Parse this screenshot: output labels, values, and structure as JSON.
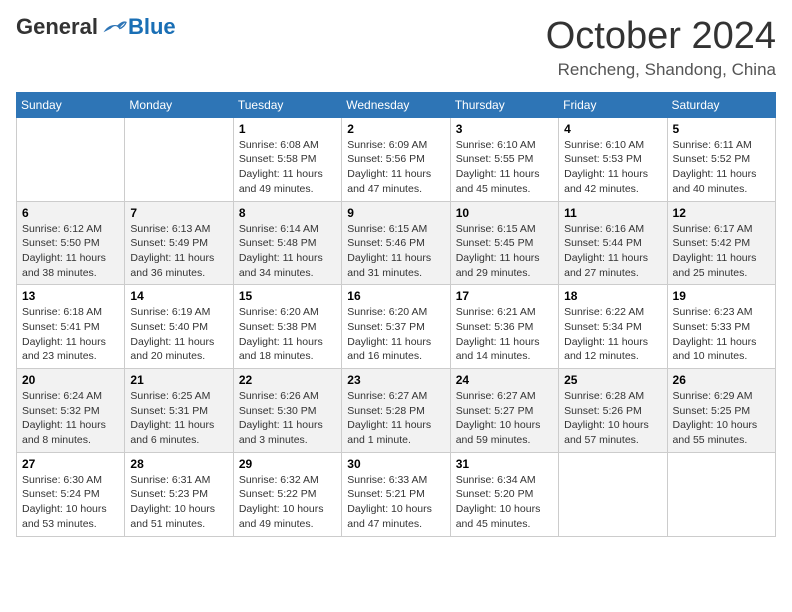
{
  "header": {
    "logo": {
      "general": "General",
      "blue": "Blue"
    },
    "title": "October 2024",
    "subtitle": "Rencheng, Shandong, China"
  },
  "days_of_week": [
    "Sunday",
    "Monday",
    "Tuesday",
    "Wednesday",
    "Thursday",
    "Friday",
    "Saturday"
  ],
  "weeks": [
    [
      {
        "day": "",
        "detail": ""
      },
      {
        "day": "",
        "detail": ""
      },
      {
        "day": "1",
        "detail": "Sunrise: 6:08 AM\nSunset: 5:58 PM\nDaylight: 11 hours and 49 minutes."
      },
      {
        "day": "2",
        "detail": "Sunrise: 6:09 AM\nSunset: 5:56 PM\nDaylight: 11 hours and 47 minutes."
      },
      {
        "day": "3",
        "detail": "Sunrise: 6:10 AM\nSunset: 5:55 PM\nDaylight: 11 hours and 45 minutes."
      },
      {
        "day": "4",
        "detail": "Sunrise: 6:10 AM\nSunset: 5:53 PM\nDaylight: 11 hours and 42 minutes."
      },
      {
        "day": "5",
        "detail": "Sunrise: 6:11 AM\nSunset: 5:52 PM\nDaylight: 11 hours and 40 minutes."
      }
    ],
    [
      {
        "day": "6",
        "detail": "Sunrise: 6:12 AM\nSunset: 5:50 PM\nDaylight: 11 hours and 38 minutes."
      },
      {
        "day": "7",
        "detail": "Sunrise: 6:13 AM\nSunset: 5:49 PM\nDaylight: 11 hours and 36 minutes."
      },
      {
        "day": "8",
        "detail": "Sunrise: 6:14 AM\nSunset: 5:48 PM\nDaylight: 11 hours and 34 minutes."
      },
      {
        "day": "9",
        "detail": "Sunrise: 6:15 AM\nSunset: 5:46 PM\nDaylight: 11 hours and 31 minutes."
      },
      {
        "day": "10",
        "detail": "Sunrise: 6:15 AM\nSunset: 5:45 PM\nDaylight: 11 hours and 29 minutes."
      },
      {
        "day": "11",
        "detail": "Sunrise: 6:16 AM\nSunset: 5:44 PM\nDaylight: 11 hours and 27 minutes."
      },
      {
        "day": "12",
        "detail": "Sunrise: 6:17 AM\nSunset: 5:42 PM\nDaylight: 11 hours and 25 minutes."
      }
    ],
    [
      {
        "day": "13",
        "detail": "Sunrise: 6:18 AM\nSunset: 5:41 PM\nDaylight: 11 hours and 23 minutes."
      },
      {
        "day": "14",
        "detail": "Sunrise: 6:19 AM\nSunset: 5:40 PM\nDaylight: 11 hours and 20 minutes."
      },
      {
        "day": "15",
        "detail": "Sunrise: 6:20 AM\nSunset: 5:38 PM\nDaylight: 11 hours and 18 minutes."
      },
      {
        "day": "16",
        "detail": "Sunrise: 6:20 AM\nSunset: 5:37 PM\nDaylight: 11 hours and 16 minutes."
      },
      {
        "day": "17",
        "detail": "Sunrise: 6:21 AM\nSunset: 5:36 PM\nDaylight: 11 hours and 14 minutes."
      },
      {
        "day": "18",
        "detail": "Sunrise: 6:22 AM\nSunset: 5:34 PM\nDaylight: 11 hours and 12 minutes."
      },
      {
        "day": "19",
        "detail": "Sunrise: 6:23 AM\nSunset: 5:33 PM\nDaylight: 11 hours and 10 minutes."
      }
    ],
    [
      {
        "day": "20",
        "detail": "Sunrise: 6:24 AM\nSunset: 5:32 PM\nDaylight: 11 hours and 8 minutes."
      },
      {
        "day": "21",
        "detail": "Sunrise: 6:25 AM\nSunset: 5:31 PM\nDaylight: 11 hours and 6 minutes."
      },
      {
        "day": "22",
        "detail": "Sunrise: 6:26 AM\nSunset: 5:30 PM\nDaylight: 11 hours and 3 minutes."
      },
      {
        "day": "23",
        "detail": "Sunrise: 6:27 AM\nSunset: 5:28 PM\nDaylight: 11 hours and 1 minute."
      },
      {
        "day": "24",
        "detail": "Sunrise: 6:27 AM\nSunset: 5:27 PM\nDaylight: 10 hours and 59 minutes."
      },
      {
        "day": "25",
        "detail": "Sunrise: 6:28 AM\nSunset: 5:26 PM\nDaylight: 10 hours and 57 minutes."
      },
      {
        "day": "26",
        "detail": "Sunrise: 6:29 AM\nSunset: 5:25 PM\nDaylight: 10 hours and 55 minutes."
      }
    ],
    [
      {
        "day": "27",
        "detail": "Sunrise: 6:30 AM\nSunset: 5:24 PM\nDaylight: 10 hours and 53 minutes."
      },
      {
        "day": "28",
        "detail": "Sunrise: 6:31 AM\nSunset: 5:23 PM\nDaylight: 10 hours and 51 minutes."
      },
      {
        "day": "29",
        "detail": "Sunrise: 6:32 AM\nSunset: 5:22 PM\nDaylight: 10 hours and 49 minutes."
      },
      {
        "day": "30",
        "detail": "Sunrise: 6:33 AM\nSunset: 5:21 PM\nDaylight: 10 hours and 47 minutes."
      },
      {
        "day": "31",
        "detail": "Sunrise: 6:34 AM\nSunset: 5:20 PM\nDaylight: 10 hours and 45 minutes."
      },
      {
        "day": "",
        "detail": ""
      },
      {
        "day": "",
        "detail": ""
      }
    ]
  ]
}
